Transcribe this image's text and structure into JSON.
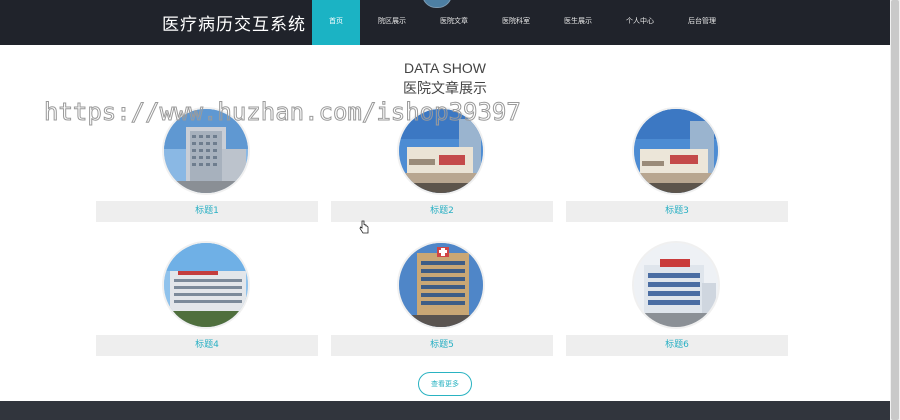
{
  "header": {
    "brand": "医疗病历交互系统",
    "nav": [
      {
        "label": "首页",
        "active": true
      },
      {
        "label": "院区展示"
      },
      {
        "label": "医院文章"
      },
      {
        "label": "医院科室"
      },
      {
        "label": "医生展示"
      },
      {
        "label": "个人中心"
      },
      {
        "label": "后台管理"
      }
    ]
  },
  "section": {
    "title_en": "DATA SHOW",
    "title_cn": "医院文章展示"
  },
  "watermark": "https://www.huzhan.com/ishop39397",
  "cards": [
    {
      "label": "标题1"
    },
    {
      "label": "标题2"
    },
    {
      "label": "标题3"
    },
    {
      "label": "标题4"
    },
    {
      "label": "标题5"
    },
    {
      "label": "标题6"
    }
  ],
  "more_button": "查看更多",
  "colors": {
    "accent": "#1bb3c4",
    "header_bg": "#20232b",
    "footer_bg": "#31353d",
    "card_label_bg": "#eeeeee"
  }
}
